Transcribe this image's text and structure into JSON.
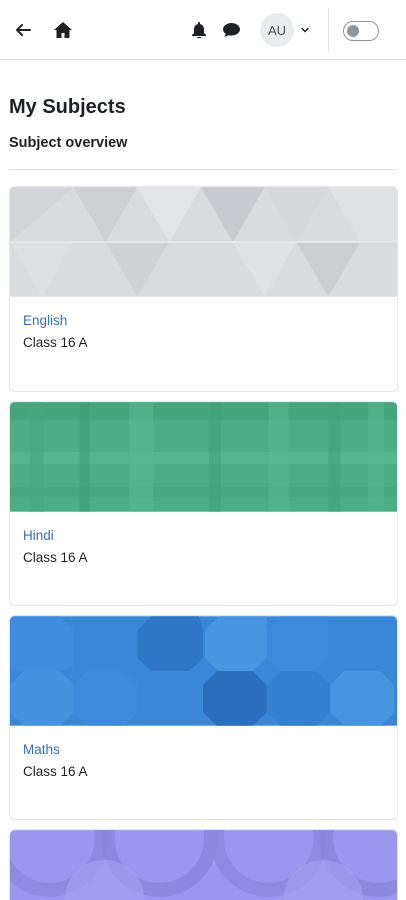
{
  "header": {
    "avatar_initials": "AU",
    "icons": [
      "back-arrow-icon",
      "home-icon",
      "bell-icon",
      "chat-icon",
      "chevron-down-icon"
    ],
    "theme_toggle_on": false
  },
  "page": {
    "title": "My Subjects",
    "subtitle": "Subject overview"
  },
  "subjects": [
    {
      "name": "English",
      "class": "Class 16 A",
      "color": "#d6dadd"
    },
    {
      "name": "Hindi",
      "class": "Class 16 A",
      "color": "#4ead85"
    },
    {
      "name": "Maths",
      "class": "Class 16 A",
      "color": "#3a87d8"
    },
    {
      "name": "",
      "class": "",
      "color": "#9a98ee"
    }
  ]
}
